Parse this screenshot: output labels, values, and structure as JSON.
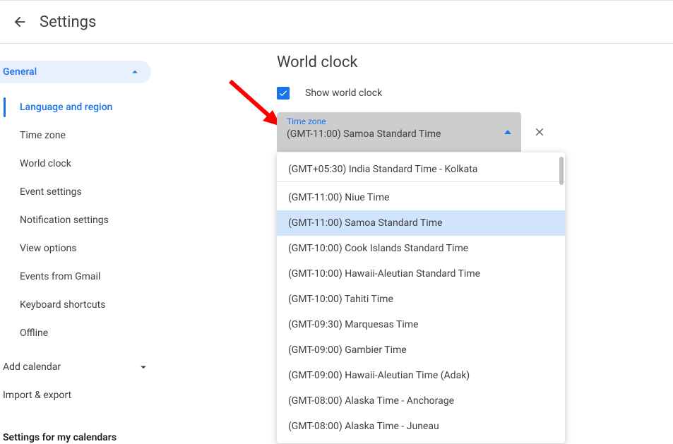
{
  "header": {
    "title": "Settings"
  },
  "sidebar": {
    "activeSection": "General",
    "items": [
      "Language and region",
      "Time zone",
      "World clock",
      "Event settings",
      "Notification settings",
      "View options",
      "Events from Gmail",
      "Keyboard shortcuts",
      "Offline"
    ],
    "activeItemIndex": 0,
    "addCalendar": "Add calendar",
    "importExport": "Import & export",
    "myCalendarsHeading": "Settings for my calendars"
  },
  "main": {
    "sectionTitle": "World clock",
    "checkboxLabel": "Show world clock",
    "checkboxChecked": true,
    "select": {
      "floatingLabel": "Time zone",
      "value": "(GMT-11:00) Samoa Standard Time"
    },
    "dropdown": {
      "currentOption": "(GMT+05:30) India Standard Time - Kolkata",
      "selectedIndex": 1,
      "options": [
        "(GMT-11:00) Niue Time",
        "(GMT-11:00) Samoa Standard Time",
        "(GMT-10:00) Cook Islands Standard Time",
        "(GMT-10:00) Hawaii-Aleutian Standard Time",
        "(GMT-10:00) Tahiti Time",
        "(GMT-09:30) Marquesas Time",
        "(GMT-09:00) Gambier Time",
        "(GMT-09:00) Hawaii-Aleutian Time (Adak)",
        "(GMT-08:00) Alaska Time - Anchorage",
        "(GMT-08:00) Alaska Time - Juneau"
      ]
    }
  },
  "colors": {
    "accent": "#1a73e8",
    "chipBg": "#e8f0fe",
    "selectedOptionBg": "#d2e3fc",
    "annotationArrow": "#ff0000"
  }
}
